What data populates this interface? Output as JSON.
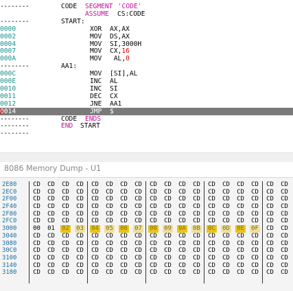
{
  "code_lines": [
    {
      "dash": "--------",
      "label": "CODE",
      "op": "",
      "arg": "",
      "seg": [
        "SEGMENT",
        " 'CODE'"
      ],
      "type": "segment"
    },
    {
      "dash": "",
      "label": "",
      "op": "ASSUME",
      "arg": "CS:CODE",
      "type": "assume"
    },
    {
      "dash": "--------",
      "label": "START:",
      "op": "",
      "arg": "",
      "type": "label"
    },
    {
      "addr": "0000",
      "op": "XOR",
      "arg": "AX,AX"
    },
    {
      "addr": "0002",
      "op": "MOV",
      "arg": "DS,AX"
    },
    {
      "addr": "0004",
      "op": "MOV",
      "arg": "SI,3000H"
    },
    {
      "addr": "0007",
      "op": "MOV",
      "arg": "CX,",
      "num": "16"
    },
    {
      "addr": "000A",
      "op": "MOV",
      "arg": " AL,",
      "num": "0"
    },
    {
      "dash": "--------",
      "label": "AA1:",
      "type": "label"
    },
    {
      "addr": "000C",
      "op": "MOV",
      "arg": "[SI],AL"
    },
    {
      "addr": "000E",
      "op": "INC",
      "arg": "AL"
    },
    {
      "addr": "0010",
      "op": "INC",
      "arg": "SI"
    },
    {
      "addr": "0011",
      "op": "DEC",
      "arg": "CX"
    },
    {
      "addr": "0012",
      "op": "JNE",
      "arg": "AA1"
    },
    {
      "addr": "0014",
      "op": "JMP",
      "arg": "$",
      "current": true
    },
    {
      "dash": "--------",
      "label": "CODE",
      "kw": "ENDS",
      "type": "ends"
    },
    {
      "dash": "--------",
      "label": "END",
      "arg": "START",
      "type": "end"
    },
    {
      "dash": "--------",
      "type": "blank"
    }
  ],
  "dump": {
    "title": "8086 Memory Dump - U1",
    "rows": [
      {
        "addr": "2E80",
        "bytes": [
          "CD",
          "CD",
          "CD",
          "CD",
          "CD",
          "CD",
          "CD",
          "CD",
          "CD",
          "CD",
          "CD",
          "CD",
          "CD",
          "CD",
          "CD",
          "CD",
          "CD",
          "CD",
          "CD",
          "CD"
        ]
      },
      {
        "addr": "2EC0",
        "bytes": [
          "CD",
          "CD",
          "CD",
          "CD",
          "CD",
          "CD",
          "CD",
          "CD",
          "CD",
          "CD",
          "CD",
          "CD",
          "CD",
          "CD",
          "CD",
          "CD",
          "CD",
          "CD",
          "CD",
          "CD"
        ]
      },
      {
        "addr": "2F00",
        "bytes": [
          "CD",
          "CD",
          "CD",
          "CD",
          "CD",
          "CD",
          "CD",
          "CD",
          "CD",
          "CD",
          "CD",
          "CD",
          "CD",
          "CD",
          "CD",
          "CD",
          "CD",
          "CD",
          "CD",
          "CD"
        ]
      },
      {
        "addr": "2F40",
        "bytes": [
          "CD",
          "CD",
          "CD",
          "CD",
          "CD",
          "CD",
          "CD",
          "CD",
          "CD",
          "CD",
          "CD",
          "CD",
          "CD",
          "CD",
          "CD",
          "CD",
          "CD",
          "CD",
          "CD",
          "CD"
        ]
      },
      {
        "addr": "2F80",
        "bytes": [
          "CD",
          "CD",
          "CD",
          "CD",
          "CD",
          "CD",
          "CD",
          "CD",
          "CD",
          "CD",
          "CD",
          "CD",
          "CD",
          "CD",
          "CD",
          "CD",
          "CD",
          "CD",
          "CD",
          "CD"
        ]
      },
      {
        "addr": "2FC0",
        "bytes": [
          "CD",
          "CD",
          "CD",
          "CD",
          "CD",
          "CD",
          "CD",
          "CD",
          "CD",
          "CD",
          "CD",
          "CD",
          "CD",
          "CD",
          "CD",
          "CD",
          "CD",
          "CD",
          "CD",
          "CD"
        ]
      },
      {
        "addr": "3000",
        "bytes": [
          "00",
          "01",
          "02",
          "03",
          "04",
          "05",
          "06",
          "07",
          "08",
          "09",
          "0A",
          "0B",
          "0C",
          "0D",
          "0E",
          "0F",
          "CD",
          "CD",
          "CD",
          "CD"
        ],
        "highlight_from": 2,
        "highlight_to": 15
      },
      {
        "addr": "3040",
        "bytes": [
          "CD",
          "CD",
          "CD",
          "CD",
          "CD",
          "CD",
          "CD",
          "CD",
          "CD",
          "CD",
          "CD",
          "CD",
          "CD",
          "CD",
          "CD",
          "CD",
          "CD",
          "CD",
          "CD",
          "CD"
        ]
      },
      {
        "addr": "3080",
        "bytes": [
          "CD",
          "CD",
          "CD",
          "CD",
          "CD",
          "CD",
          "CD",
          "CD",
          "CD",
          "CD",
          "CD",
          "CD",
          "CD",
          "CD",
          "CD",
          "CD",
          "CD",
          "CD",
          "CD",
          "CD"
        ]
      },
      {
        "addr": "30C0",
        "bytes": [
          "CD",
          "CD",
          "CD",
          "CD",
          "CD",
          "CD",
          "CD",
          "CD",
          "CD",
          "CD",
          "CD",
          "CD",
          "CD",
          "CD",
          "CD",
          "CD",
          "CD",
          "CD",
          "CD",
          "CD"
        ]
      },
      {
        "addr": "3100",
        "bytes": [
          "CD",
          "CD",
          "CD",
          "CD",
          "CD",
          "CD",
          "CD",
          "CD",
          "CD",
          "CD",
          "CD",
          "CD",
          "CD",
          "CD",
          "CD",
          "CD",
          "CD",
          "CD",
          "CD",
          "CD"
        ]
      },
      {
        "addr": "3140",
        "bytes": [
          "CD",
          "CD",
          "CD",
          "CD",
          "CD",
          "CD",
          "CD",
          "CD",
          "CD",
          "CD",
          "CD",
          "CD",
          "CD",
          "CD",
          "CD",
          "CD",
          "CD",
          "CD",
          "CD",
          "CD"
        ]
      },
      {
        "addr": "3180",
        "bytes": [
          "CD",
          "CD",
          "CD",
          "CD",
          "CD",
          "CD",
          "CD",
          "CD",
          "CD",
          "CD",
          "CD",
          "CD",
          "CD",
          "CD",
          "CD",
          "CD",
          "CD",
          "CD",
          "CD",
          "CD"
        ]
      }
    ]
  },
  "colors": {
    "address": "#1a8f8f",
    "keyword": "#c0109a",
    "number": "#d00000",
    "highlight": "#e8c51c",
    "current_line": "#7a7a7a",
    "breakpoint": "#c00000"
  }
}
